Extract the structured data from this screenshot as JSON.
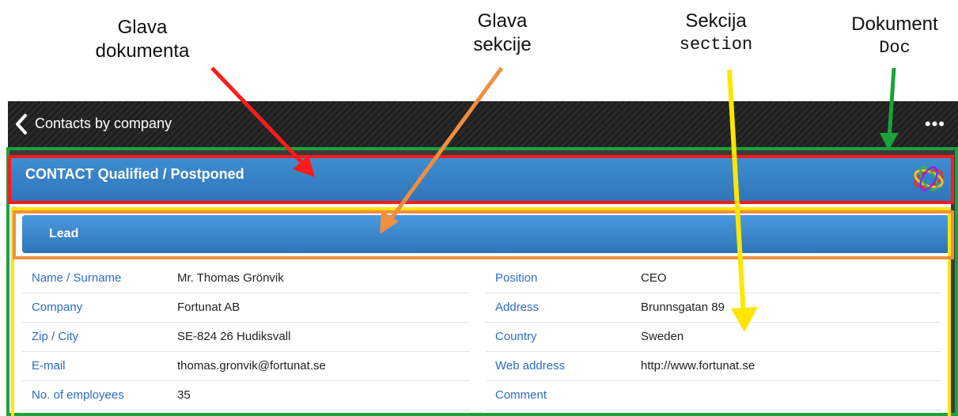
{
  "annotations": {
    "doc_head": [
      "Glava",
      "dokumenta"
    ],
    "section_head": [
      "Glava",
      "sekcije"
    ],
    "section": {
      "label": "Sekcija",
      "code": "section"
    },
    "document": {
      "label": "Dokument",
      "code": "Doc"
    }
  },
  "navbar": {
    "back_label": "Contacts by company",
    "more_glyph": "•••"
  },
  "document": {
    "title": "CONTACT Qualified / Postponed"
  },
  "section": {
    "title": "Lead"
  },
  "fields_left": [
    {
      "label": "Name / Surname",
      "value": "Mr. Thomas Grönvik"
    },
    {
      "label": "Company",
      "value": "Fortunat AB"
    },
    {
      "label": "Zip / City",
      "value": "SE-824 26 Hudiksvall"
    },
    {
      "label": "E-mail",
      "value": "thomas.gronvik@fortunat.se"
    },
    {
      "label": "No. of employees",
      "value": "35"
    }
  ],
  "fields_right": [
    {
      "label": "Position",
      "value": "CEO"
    },
    {
      "label": "Address",
      "value": "Brunnsgatan 89"
    },
    {
      "label": "Country",
      "value": "Sweden"
    },
    {
      "label": "Web address",
      "value": "http://www.fortunat.se"
    },
    {
      "label": "Comment",
      "value": ""
    }
  ],
  "colors": {
    "doc_box": "#1aa33a",
    "head_box": "#ff1a1a",
    "section_box": "#ffe600",
    "section_head_box": "#ef8f40",
    "accent_blue": "#2f74b7",
    "label_blue": "#2b6cc4"
  }
}
